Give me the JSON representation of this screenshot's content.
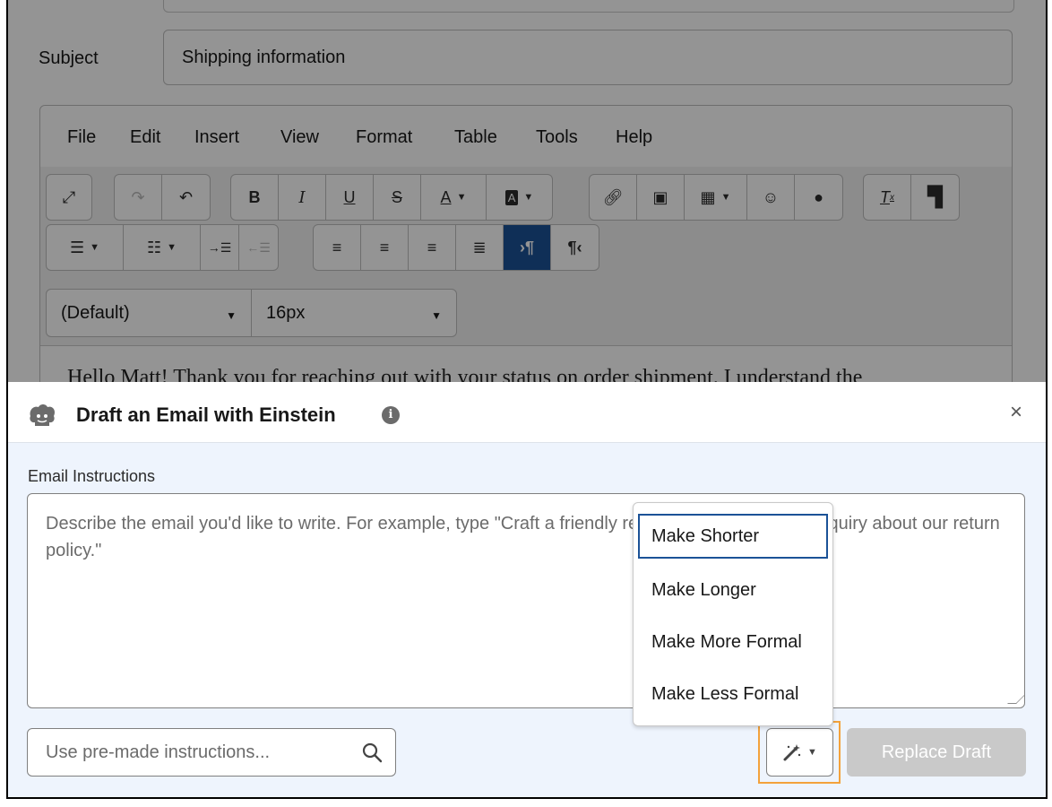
{
  "composer": {
    "subject_label": "Subject",
    "subject_value": "Shipping information",
    "menu": [
      "File",
      "Edit",
      "Insert",
      "View",
      "Format",
      "Table",
      "Tools",
      "Help"
    ],
    "toolbar": {
      "bold": "B",
      "italic": "I",
      "underline": "U",
      "strikethrough": "S",
      "text_color": "A",
      "bg_color": "A",
      "ltr": "¶",
      "rtl": "¶",
      "font_family": "(Default)",
      "font_size": "16px"
    },
    "body_text": "Hello Matt! Thank you for reaching out with your status on order shipment. I understand the"
  },
  "panel": {
    "title": "Draft an Email with Einstein",
    "info_icon": "i",
    "close_icon": "×",
    "instructions_label": "Email Instructions",
    "instructions_placeholder": "Describe the email you'd like to write. For example, type \"Craft a friendly response to a customer inquiry about our return policy.\"",
    "premade_placeholder": "Use pre-made instructions...",
    "replace_button": "Replace Draft"
  },
  "dropdown": {
    "items": [
      "Make Shorter",
      "Make Longer",
      "Make More Formal",
      "Make Less Formal"
    ],
    "focused_index": 0
  },
  "colors": {
    "accent": "#1b5297",
    "highlight_outline": "#f3a23c",
    "panel_bg": "#eef4fd",
    "disabled_button": "#c9c9c9"
  }
}
